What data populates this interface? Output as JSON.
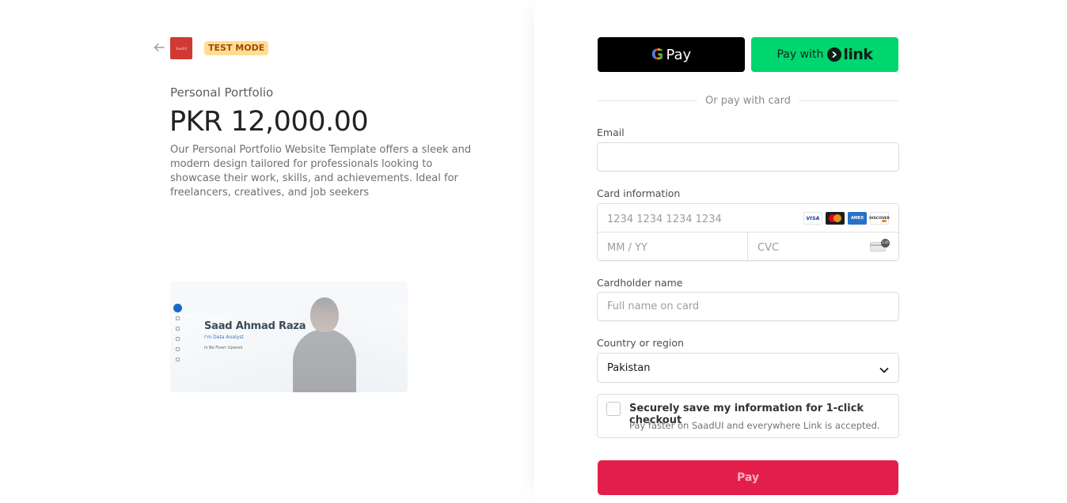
{
  "header": {
    "back_icon": "arrow-left-icon",
    "brand_logo_text": "SaadUI",
    "test_badge": "TEST MODE"
  },
  "product": {
    "name": "Personal Portfolio",
    "price": "PKR 12,000.00",
    "description": "Our Personal Portfolio Website Template offers a sleek and modern design tailored for professionals looking to showcase their work, skills, and achievements. Ideal for freelancers, creatives, and job seekers",
    "preview": {
      "hero_name": "Saad Ahmad Raza",
      "hero_sub": "I'm Data Analyst",
      "hero_links": "in  Be  Fiverr  Upwork"
    }
  },
  "wallets": {
    "gpay_g": "G",
    "gpay_label": "Pay",
    "link_prefix": "Pay with",
    "link_logo": "link"
  },
  "divider": "Or pay with card",
  "form": {
    "email_label": "Email",
    "email_value": "",
    "card_label": "Card information",
    "card_number_placeholder": "1234 1234 1234 1234",
    "expiry_placeholder": "MM / YY",
    "cvc_placeholder": "CVC",
    "card_brands": [
      "VISA",
      "mastercard",
      "AMEX",
      "DISCOVER"
    ],
    "cvc_hint": "135",
    "cardholder_label": "Cardholder name",
    "cardholder_placeholder": "Full name on card",
    "country_label": "Country or region",
    "country_value": "Pakistan"
  },
  "save_info": {
    "title": "Securely save my information for 1-click checkout",
    "subtitle": "Pay faster on SaadUI and everywhere Link is accepted."
  },
  "pay_button": "Pay",
  "colors": {
    "pay_button": "#e41e4b",
    "link_button": "#00d66f",
    "badge_bg": "#ffde92",
    "brand_logo": "#d03a34"
  }
}
